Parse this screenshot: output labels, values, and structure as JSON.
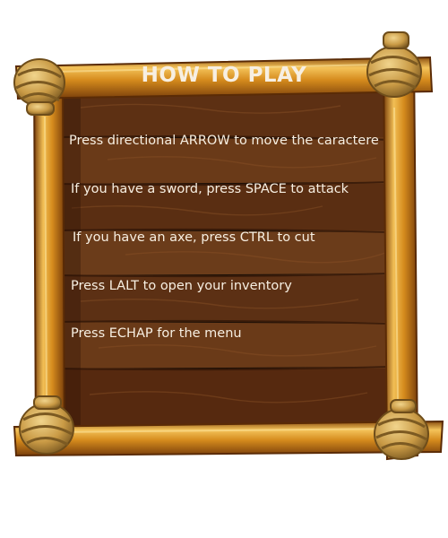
{
  "title": "HOW TO PLAY",
  "instructions": [
    "Press directional ARROW to move the caractere",
    "If you have a sword, press SPACE to attack",
    "If you have an axe, press CTRL to cut",
    "Press LALT to open your inventory",
    "Press ECHAP for the menu"
  ],
  "colors": {
    "background": "#ffffff",
    "panel_dark": "#4a2710",
    "panel_mid": "#6b3d1c",
    "frame_wood": "#d8901f",
    "frame_highlight": "#f3c257",
    "rope": "#d7b05e",
    "text": "#f7efe2"
  },
  "icons": [
    "rope-knot-icon"
  ]
}
